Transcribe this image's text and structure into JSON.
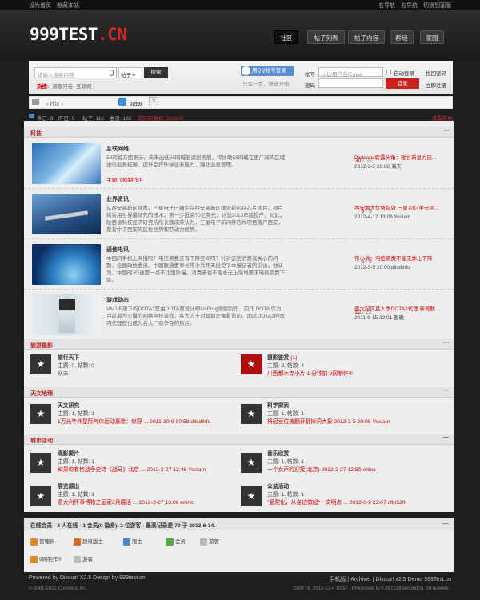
{
  "topbar": {
    "sethome": "设为首页",
    "favorite": "收藏本站",
    "nav1": "右导航",
    "nav2": "右导航",
    "switch": "切换到宽版"
  },
  "logo": {
    "main": "999TEST",
    "ext": ".CN"
  },
  "nav": [
    "社区",
    "帖子列表",
    "帖子内容",
    "群组",
    "家园"
  ],
  "search": {
    "placeholder": "请输入搜索内容",
    "type": "帖子",
    "button": "搜索",
    "hot_label": "热搜:",
    "hot": [
      "调查问卷",
      "互联网"
    ]
  },
  "qq": {
    "button": "用QQ帐号登录",
    "sub": "只需一步，快速开始"
  },
  "login": {
    "account_label": "帐号",
    "account_placeholder": "UID/用户名/Email",
    "password_label": "密码",
    "auto": "自动登录",
    "retrieve": "找回密码",
    "submit": "登录",
    "register": "立即注册"
  },
  "breadcrumb": {
    "home": "社区",
    "plugin": "9群网",
    "more": "3"
  },
  "stats": {
    "today": "今日: 9",
    "yesterday": "昨日: 9",
    "posts": "帖子: 115",
    "members": "会员: 182",
    "welcome": "欢迎新会员: 289845",
    "new": "查看新帖"
  },
  "categories": [
    {
      "name": "科技",
      "forums": [
        {
          "title": "互联网络",
          "desc": "58同城方面表示，未来出任58同城能逼剧各般，将协助58同城在更广阔的区域进行业务拓展，提升会作伙伴业务能力，强化业务管理。",
          "mod": "主题: 9网制作①",
          "count_red": "30",
          "count_rest": " / 32",
          "last_title": "Pinterest崭露头角：碰谷新星力压...",
          "last_meta": "2012-3-5 20:02 海天",
          "thumb": "net"
        },
        {
          "title": "业界资讯",
          "desc": "从西安高新区获悉，三星电子已确定在西安高新区建设新闪存芯片项目，项目将采用世界最领先的技术，第一步投资70亿美元，计划2013年底投产。对此，陕西省科技经济研究所所长魏成荣认为，三星电子新闪存芯片项目落户西安，是看中了西安的区位优势和劳动力优势。",
          "mod": "",
          "count_red": "9",
          "count_rest": " / 9",
          "last_title": "西安两大优势起效 三星70亿美元项...",
          "last_meta": "2012-4-17 13:06 Yeslam",
          "thumb": "jet"
        },
        {
          "title": "通信电讯",
          "desc": "中国的手机上网慢吗？电信资费还有下降空间吗？针对这些消费者关心的问题，全国政协委员、中国联通董事长常小兵昨天接受了本报记者的采访。他认为，中国的3G速度一点不比国外慢，消费者也不能永无止境地要求电信资费下降。",
          "mod": "",
          "count_red": "5",
          "count_rest": " / 5",
          "last_title": "常小兵：电信资费不能无休止下降",
          "last_meta": "2012-3-5 20:00 dilsdihfo",
          "thumb": "earth"
        },
        {
          "title": "游戏动态",
          "desc": "VALVE旗下的DOTA2是由DOTA原设计师IceFrog领衔制作，前作 DOTA 作为目前最为火爆的网络竞技游戏，各大人士对其都是像看重的，因此DOTA2的国内代理权也成为各大厂商争夺的焦点。",
          "mod": "",
          "count_red": "22",
          "count_rest": " / 22",
          "last_title": "盛大起风且人争DOTA2代理 新竞联...",
          "last_meta": "2011-9-15 22:01 暂暖",
          "thumb": "game"
        }
      ]
    },
    {
      "name": "旅游摄影",
      "grid": [
        {
          "title": "旅行天下",
          "l1": "主题: 0, 帖数: 0",
          "l2": "从未",
          "red": false
        },
        {
          "title": "摄影鉴赏",
          "badge": "(1)",
          "l1": "主题: 3, 帖数: 4",
          "l2": "川西都木寺小片 1 分钟前 9网制作①",
          "red": true
        }
      ]
    },
    {
      "name": "天文地理",
      "grid": [
        {
          "title": "天文研究",
          "l1": "主题: 1, 帖数: 1",
          "l2": "1万光年外星际气体运动暴徐：似野 ... 2011-10-9 00:58 dilsdihfo",
          "red": false
        },
        {
          "title": "科学探索",
          "l1": "主题: 1, 帖数: 1",
          "l2": "将冠豆位被翻开翻掉洞大象 2012-3-5 20:06 Yeslam",
          "red": false
        }
      ]
    },
    {
      "name": "城市活动",
      "grid": [
        {
          "title": "观影聚片",
          "l1": "主题: 1, 帖数: 1",
          "l2": "如果你有格战争史诗《战马》北京 ... 2012-2-27 12:46 Yeslam",
          "red": false
        },
        {
          "title": "音乐欣赏",
          "l1": "主题: 1, 帖数: 1",
          "l2": "一个女声的迎接(北京) 2012-2-27 12:59 erlinc",
          "red": false
        },
        {
          "title": "展览展出",
          "l1": "主题: 1, 帖数: 1",
          "l2": "意大利怀事博物之画家2月展活 ... 2012-2-27 13:06 erlinc",
          "red": false
        },
        {
          "title": "公益活动",
          "l1": "主题: 1, 帖数: 1",
          "l2": "\"爱爬化，从身边做起\"一文明点 ... 2012-6-9 23:07 cflp520",
          "red": false
        }
      ]
    }
  ],
  "online": {
    "header": "在线会员 - 3 人在线 - 1 会员(0 隐身), 2 位游客 - 最高记录是 79 于 2012-6-14.",
    "legend": [
      "管理员",
      "超级版主",
      "版主",
      "会员"
    ],
    "users": [
      {
        "name": "游客"
      },
      {
        "name": "9网制作①"
      },
      {
        "name": "游客"
      }
    ]
  },
  "footer": {
    "powered": "Powered by Discuz! X2.5 Design by 999test.cn",
    "copyright": "© 2001-2012 Comsenz Inc.",
    "links": "手机版 | Archiver | Discuz! x2.5 Demo 999Test.cn",
    "time": "GMT+8, 2012-12-4 10:57 , Processed in 0.267238 second(s), 10 queries ."
  },
  "colors": {
    "accent": "#c8201c",
    "dark": "#1e1e1e"
  }
}
